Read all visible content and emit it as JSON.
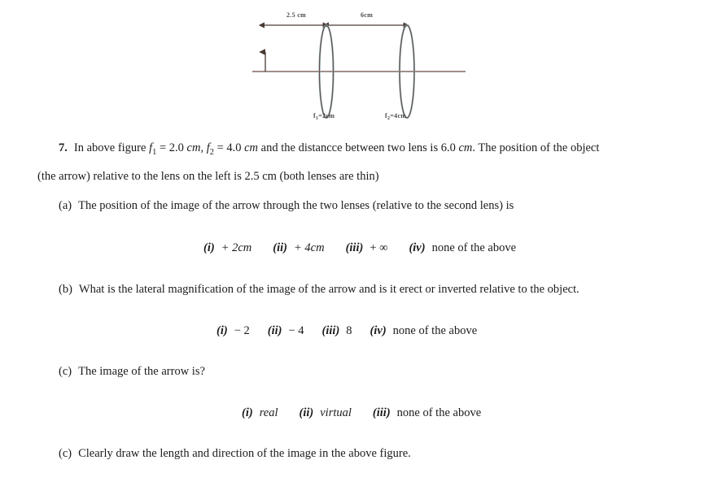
{
  "figure": {
    "name": "two-thin-lens-optical-diagram",
    "labels": {
      "distance_object_to_lens1": "2.5 cm",
      "distance_between_lenses": "6cm",
      "focal_length_1_prefix": "f",
      "focal_length_1_sub": "1",
      "focal_length_1_value": "=2cm",
      "focal_length_2_prefix": "f",
      "focal_length_2_sub": "2",
      "focal_length_2_value": "=4cm"
    },
    "colors": {
      "line": "#6b4a43",
      "lens_outline": "#6b4a43",
      "lens_highlight": "#8ab4bd",
      "label_text": "#4a4a4a"
    }
  },
  "question": {
    "number": "7.",
    "line1_a": "In above figure ",
    "f1": "f",
    "f1_sub": "1",
    "f1_val": " = 2.0 ",
    "cm1": "cm",
    "comma": ", ",
    "f2": "f",
    "f2_sub": "2",
    "f2_val": " = 4.0 ",
    "cm2": "cm",
    "line1_b": " and the distancce between two lens is 6.0 ",
    "cm3": "cm",
    "line1_c": ". The position of the object",
    "line2": "(the arrow) relative to the lens on the left is 2.5 cm (both lenses are thin)"
  },
  "parts": {
    "a": {
      "label": "(a)",
      "text": "The position of the image of the arrow through the two lenses (relative to the second lens) is",
      "options": [
        {
          "marker": "(i)",
          "text": "+ 2cm",
          "italic": true
        },
        {
          "marker": "(ii)",
          "text": "+ 4cm",
          "italic": true
        },
        {
          "marker": "(iii)",
          "text": "+ ∞",
          "italic": false
        },
        {
          "marker": "(iv)",
          "text": "none of the above",
          "italic": false
        }
      ]
    },
    "b": {
      "label": "(b)",
      "text": "What is the lateral magnification of the image of the arrow and is it erect or inverted relative to the object.",
      "options": [
        {
          "marker": "(i)",
          "text": "− 2",
          "italic": false
        },
        {
          "marker": "(ii)",
          "text": "− 4",
          "italic": false
        },
        {
          "marker": "(iii)",
          "text": "8",
          "italic": false
        },
        {
          "marker": "(iv)",
          "text": "none of the above",
          "italic": false
        }
      ]
    },
    "c": {
      "label": "(c)",
      "text": "The image of the arrow is?",
      "options": [
        {
          "marker": "(i)",
          "text": "real",
          "italic": true
        },
        {
          "marker": "(ii)",
          "text": "virtual",
          "italic": true
        },
        {
          "marker": "(iii)",
          "text": "none of the above",
          "italic": false
        }
      ]
    },
    "d": {
      "label": "(c)",
      "text": "Clearly draw the length and direction of the image in the above figure."
    }
  }
}
